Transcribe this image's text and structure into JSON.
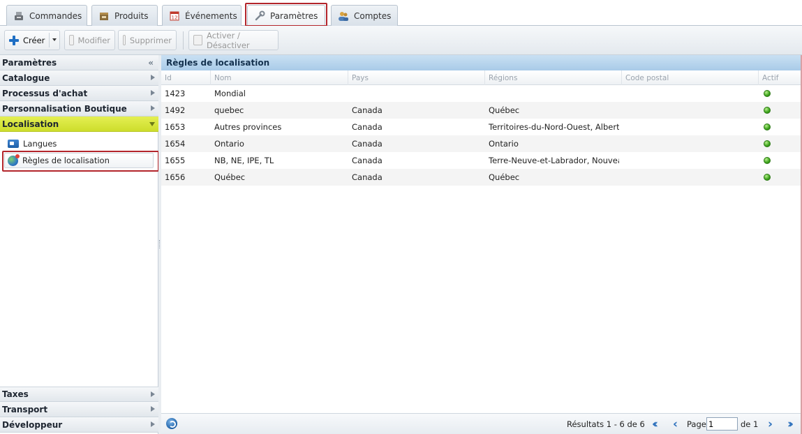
{
  "tabs": [
    {
      "label": "Commandes",
      "icon": "register-icon"
    },
    {
      "label": "Produits",
      "icon": "box-icon"
    },
    {
      "label": "Événements",
      "icon": "calendar-icon"
    },
    {
      "label": "Paramètres",
      "icon": "wrench-icon"
    },
    {
      "label": "Comptes",
      "icon": "users-icon"
    }
  ],
  "active_tab": "Paramètres",
  "toolbar": {
    "create_label": "Créer",
    "modify_label": "Modifier",
    "delete_label": "Supprimer",
    "toggle_label": "Activer / Désactiver"
  },
  "sidebar": {
    "title": "Paramètres",
    "sections": [
      {
        "label": "Catalogue"
      },
      {
        "label": "Processus d'achat"
      },
      {
        "label": "Personnalisation Boutique"
      },
      {
        "label": "Localisation"
      }
    ],
    "localisation_items": [
      {
        "label": "Langues",
        "icon": "flag-icon"
      },
      {
        "label": "Règles de localisation",
        "icon": "globe-icon"
      }
    ],
    "bottom_sections": [
      {
        "label": "Taxes"
      },
      {
        "label": "Transport"
      },
      {
        "label": "Développeur"
      }
    ]
  },
  "grid": {
    "title": "Règles de localisation",
    "columns": [
      "Id",
      "Nom",
      "Pays",
      "Régions",
      "Code postal",
      "Actif"
    ],
    "rows": [
      {
        "id": "1423",
        "nom": "Mondial",
        "pays": "",
        "regions": "",
        "code_postal": "",
        "actif": true
      },
      {
        "id": "1492",
        "nom": "quebec",
        "pays": "Canada",
        "regions": "Québec",
        "code_postal": "",
        "actif": true
      },
      {
        "id": "1653",
        "nom": "Autres provinces",
        "pays": "Canada",
        "regions": "Territoires-du-Nord-Ouest, Alberta",
        "code_postal": "",
        "actif": true
      },
      {
        "id": "1654",
        "nom": "Ontario",
        "pays": "Canada",
        "regions": "Ontario",
        "code_postal": "",
        "actif": true
      },
      {
        "id": "1655",
        "nom": "NB, NE, IPE, TL",
        "pays": "Canada",
        "regions": "Terre-Neuve-et-Labrador, Nouveau",
        "code_postal": "",
        "actif": true
      },
      {
        "id": "1656",
        "nom": "Québec",
        "pays": "Canada",
        "regions": "Québec",
        "code_postal": "",
        "actif": true
      }
    ]
  },
  "paging": {
    "results_text": "Résultats 1 - 6 de 6",
    "page_label": "Page",
    "page_value": "1",
    "of_text": "de 1"
  },
  "colors": {
    "active_section": "#d6e43a",
    "grid_header": "#b3d1ec",
    "highlight": "#b3252b",
    "active_dot": "#3aa11a"
  }
}
